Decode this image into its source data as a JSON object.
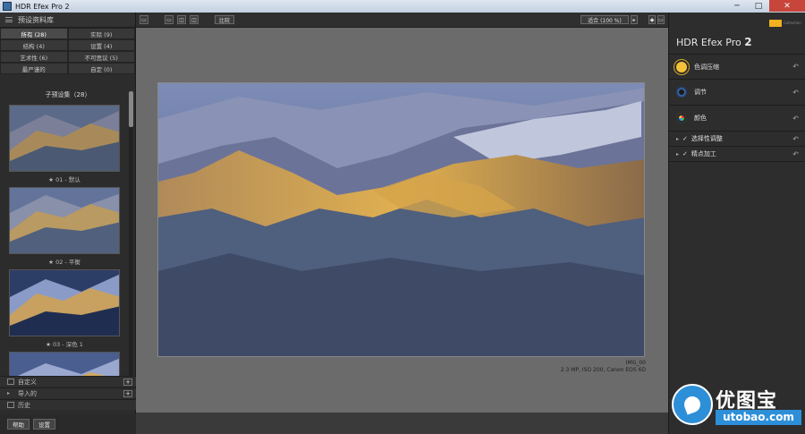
{
  "window": {
    "title": "HDR Efex Pro 2",
    "buttons": [
      "─",
      "□",
      "✕"
    ]
  },
  "left_panel": {
    "header": "预设资料库",
    "categories": [
      {
        "label": "所有 (28)",
        "active": true
      },
      {
        "label": "实际 (9)"
      },
      {
        "label": "结构 (4)"
      },
      {
        "label": "设置 (4)"
      },
      {
        "label": "艺术性 (6)"
      },
      {
        "label": "不可思议 (5)"
      },
      {
        "label": "最严谨的"
      },
      {
        "label": "自定 (0)"
      }
    ],
    "presets_title": "子预设集（28）",
    "presets": [
      {
        "caption": "★ 01 - 默认"
      },
      {
        "caption": "★ 02 - 平衡"
      },
      {
        "caption": "★ 03 - 深色 1"
      },
      {
        "caption": ""
      }
    ],
    "rows": {
      "custom": "自定义",
      "import": "导入的",
      "history": "历史"
    },
    "buttons": {
      "help": "帮助",
      "settings": "设置"
    }
  },
  "toolbar": {
    "compare": "比较",
    "zoom": "适合 (100 %)"
  },
  "photo": {
    "meta_line1": "IMG_00",
    "meta_line2": "2.3 MP, ISO 200, Canon EOS 6D"
  },
  "right_panel": {
    "brand": "HDR Efex Pro",
    "brand_version": "2",
    "vendor": "Collection",
    "sections": [
      {
        "label": "色调压缩",
        "icon": "sun-icon"
      },
      {
        "label": "调节",
        "icon": "lens-icon"
      },
      {
        "label": "颜色",
        "icon": "color-wheel-icon"
      },
      {
        "label": "选择性调整",
        "collapsible": true
      },
      {
        "label": "精点加工",
        "collapsible": true
      }
    ]
  },
  "watermark": {
    "text": "优图宝",
    "url": "utobao.com"
  }
}
